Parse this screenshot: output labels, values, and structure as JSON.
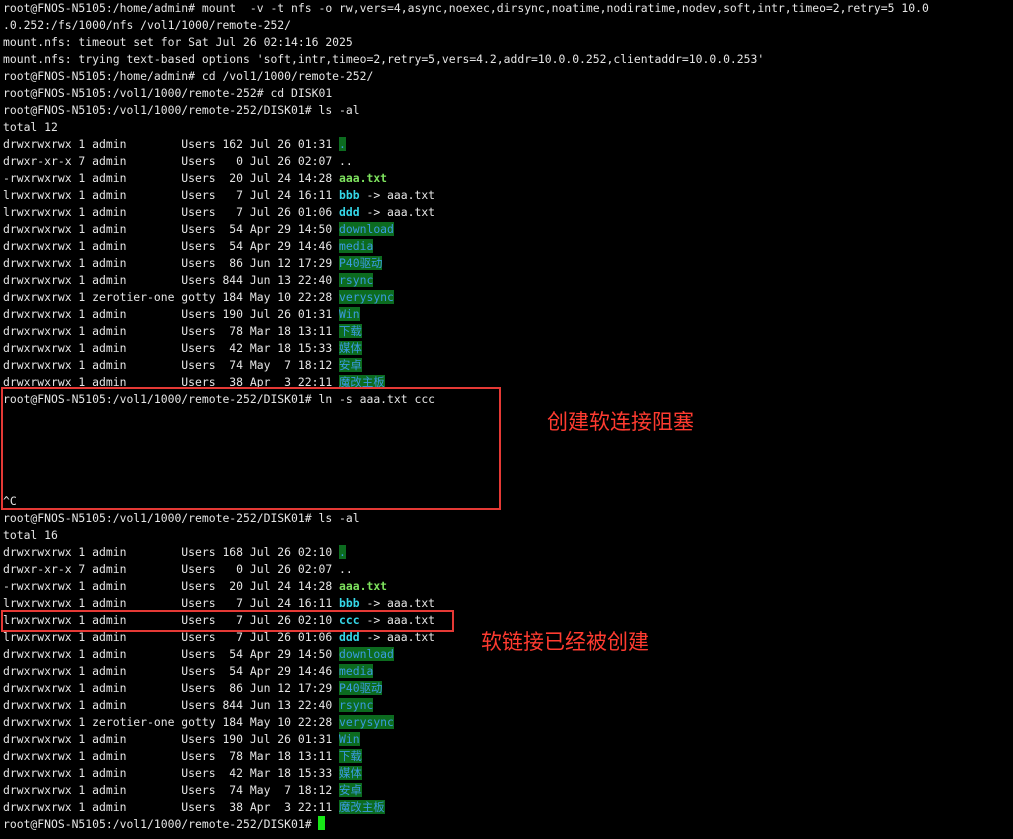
{
  "session_top": {
    "wrapped_lines": [
      "root@FNOS-N5105:/home/admin# mount  -v -t nfs -o rw,vers=4,async,noexec,dirsync,noatime,nodiratime,nodev,soft,intr,timeo=2,retry=5 10.0",
      ".0.252:/fs/1000/nfs /vol1/1000/remote-252/",
      "mount.nfs: timeout set for Sat Jul 26 02:14:16 2025",
      "mount.nfs: trying text-based options 'soft,intr,timeo=2,retry=5,vers=4.2,addr=10.0.0.252,clientaddr=10.0.0.253'",
      "root@FNOS-N5105:/home/admin# cd /vol1/1000/remote-252/",
      "root@FNOS-N5105:/vol1/1000/remote-252# cd DISK01",
      "root@FNOS-N5105:/vol1/1000/remote-252/DISK01# ls -al"
    ],
    "total": "total 12"
  },
  "listing_1": [
    {
      "prefix": "drwxrwxrwx 1 admin        Users 162 Jul 26 01:31 ",
      "name": ".",
      "kind": "dir"
    },
    {
      "prefix": "drwxr-xr-x 7 admin        Users   0 Jul 26 02:07 ",
      "name": "..",
      "kind": "plain"
    },
    {
      "prefix": "-rwxrwxrwx 1 admin        Users  20 Jul 24 14:28 ",
      "name": "aaa.txt",
      "kind": "exec"
    },
    {
      "prefix": "lrwxrwxrwx 1 admin        Users   7 Jul 24 16:11 ",
      "name": "bbb",
      "kind": "link",
      "target": " -> aaa.txt"
    },
    {
      "prefix": "lrwxrwxrwx 1 admin        Users   7 Jul 26 01:06 ",
      "name": "ddd",
      "kind": "link",
      "target": " -> aaa.txt"
    },
    {
      "prefix": "drwxrwxrwx 1 admin        Users  54 Apr 29 14:50 ",
      "name": "download",
      "kind": "dir"
    },
    {
      "prefix": "drwxrwxrwx 1 admin        Users  54 Apr 29 14:46 ",
      "name": "media",
      "kind": "dir"
    },
    {
      "prefix": "drwxrwxrwx 1 admin        Users  86 Jun 12 17:29 ",
      "name": "P40驱动",
      "kind": "dir"
    },
    {
      "prefix": "drwxrwxrwx 1 admin        Users 844 Jun 13 22:40 ",
      "name": "rsync",
      "kind": "dir"
    },
    {
      "prefix": "drwxrwxrwx 1 zerotier-one gotty 184 May 10 22:28 ",
      "name": "verysync",
      "kind": "dir"
    },
    {
      "prefix": "drwxrwxrwx 1 admin        Users 190 Jul 26 01:31 ",
      "name": "Win",
      "kind": "dir"
    },
    {
      "prefix": "drwxrwxrwx 1 admin        Users  78 Mar 18 13:11 ",
      "name": "下载",
      "kind": "dir"
    },
    {
      "prefix": "drwxrwxrwx 1 admin        Users  42 Mar 18 15:33 ",
      "name": "媒体",
      "kind": "dir"
    },
    {
      "prefix": "drwxrwxrwx 1 admin        Users  74 May  7 18:12 ",
      "name": "安卓",
      "kind": "dir"
    },
    {
      "prefix": "drwxrwxrwx 1 admin        Users  38 Apr  3 22:11 ",
      "name": "魔改主板",
      "kind": "dir"
    }
  ],
  "blocked_command": "root@FNOS-N5105:/vol1/1000/remote-252/DISK01# ln -s aaa.txt ccc",
  "interrupt": "^C",
  "second_ls": "root@FNOS-N5105:/vol1/1000/remote-252/DISK01# ls -al",
  "total_2": "total 16",
  "listing_2": [
    {
      "prefix": "drwxrwxrwx 1 admin        Users 168 Jul 26 02:10 ",
      "name": ".",
      "kind": "dir"
    },
    {
      "prefix": "drwxr-xr-x 7 admin        Users   0 Jul 26 02:07 ",
      "name": "..",
      "kind": "plain"
    },
    {
      "prefix": "-rwxrwxrwx 1 admin        Users  20 Jul 24 14:28 ",
      "name": "aaa.txt",
      "kind": "exec"
    },
    {
      "prefix": "lrwxrwxrwx 1 admin        Users   7 Jul 24 16:11 ",
      "name": "bbb",
      "kind": "link",
      "target": " -> aaa.txt"
    },
    {
      "prefix": "lrwxrwxrwx 1 admin        Users   7 Jul 26 02:10 ",
      "name": "ccc",
      "kind": "link",
      "target": " -> aaa.txt"
    },
    {
      "prefix": "lrwxrwxrwx 1 admin        Users   7 Jul 26 01:06 ",
      "name": "ddd",
      "kind": "link",
      "target": " -> aaa.txt"
    },
    {
      "prefix": "drwxrwxrwx 1 admin        Users  54 Apr 29 14:50 ",
      "name": "download",
      "kind": "dir"
    },
    {
      "prefix": "drwxrwxrwx 1 admin        Users  54 Apr 29 14:46 ",
      "name": "media",
      "kind": "dir"
    },
    {
      "prefix": "drwxrwxrwx 1 admin        Users  86 Jun 12 17:29 ",
      "name": "P40驱动",
      "kind": "dir"
    },
    {
      "prefix": "drwxrwxrwx 1 admin        Users 844 Jun 13 22:40 ",
      "name": "rsync",
      "kind": "dir"
    },
    {
      "prefix": "drwxrwxrwx 1 zerotier-one gotty 184 May 10 22:28 ",
      "name": "verysync",
      "kind": "dir"
    },
    {
      "prefix": "drwxrwxrwx 1 admin        Users 190 Jul 26 01:31 ",
      "name": "Win",
      "kind": "dir"
    },
    {
      "prefix": "drwxrwxrwx 1 admin        Users  78 Mar 18 13:11 ",
      "name": "下载",
      "kind": "dir"
    },
    {
      "prefix": "drwxrwxrwx 1 admin        Users  42 Mar 18 15:33 ",
      "name": "媒体",
      "kind": "dir"
    },
    {
      "prefix": "drwxrwxrwx 1 admin        Users  74 May  7 18:12 ",
      "name": "安卓",
      "kind": "dir"
    },
    {
      "prefix": "drwxrwxrwx 1 admin        Users  38 Apr  3 22:11 ",
      "name": "魔改主板",
      "kind": "dir"
    }
  ],
  "final_prompt": "root@FNOS-N5105:/vol1/1000/remote-252/DISK01# ",
  "annotations": {
    "blocked_note": "创建软连接阻塞",
    "created_note": "软链接已经被创建"
  },
  "colors": {
    "background": "#000000",
    "text": "#e6e6e6",
    "dir_highlight_bg": "#0c6b1f",
    "dir_text": "#3a9be0",
    "exec_file": "#7ee35e",
    "symlink": "#35d7e8",
    "annotation_red": "#e53935",
    "cursor": "#17e817"
  }
}
